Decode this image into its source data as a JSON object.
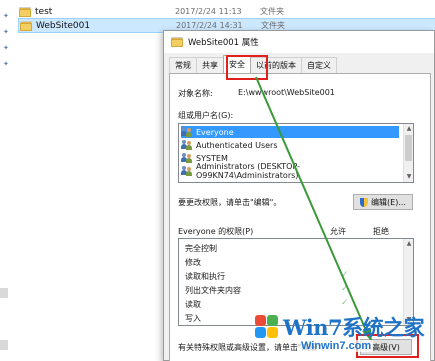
{
  "explorer": {
    "files": [
      {
        "name": "test",
        "date": "2017/2/24 11:13",
        "type": "文件夹"
      },
      {
        "name": "WebSite001",
        "date": "2017/2/24 14:31",
        "type": "文件夹"
      }
    ]
  },
  "dialog": {
    "title": "WebSite001 属性",
    "tabs": [
      "常规",
      "共享",
      "安全",
      "以前的版本",
      "自定义"
    ],
    "active_tab": "安全",
    "object_label": "对象名称:",
    "object_value": "E:\\wwwroot\\WebSite001",
    "groups_label": "组或用户名(G):",
    "users": [
      "Everyone",
      "Authenticated Users",
      "SYSTEM",
      "Administrators (DESKTOP-O99KN74\\Administrators)"
    ],
    "selected_user": "Everyone",
    "change_hint": "要更改权限，请单击\"编辑\"。",
    "edit_button": "编辑(E)...",
    "perm_label": "Everyone 的权限(P)",
    "allow_header": "允许",
    "deny_header": "拒绝",
    "permissions": [
      "完全控制",
      "修改",
      "读取和执行",
      "列出文件夹内容",
      "读取",
      "写入"
    ],
    "allowed": [
      false,
      false,
      true,
      true,
      true,
      false
    ],
    "special_hint": "有关特殊权限或高级设置，请单击\"高级\"。",
    "advanced_button": "高级(V)",
    "highlight_color": "#e0201e",
    "arrow_color": "#3a9a3a"
  },
  "watermark": {
    "brand_main": "Win7系统之家",
    "brand_url": "Winwin7.com"
  }
}
